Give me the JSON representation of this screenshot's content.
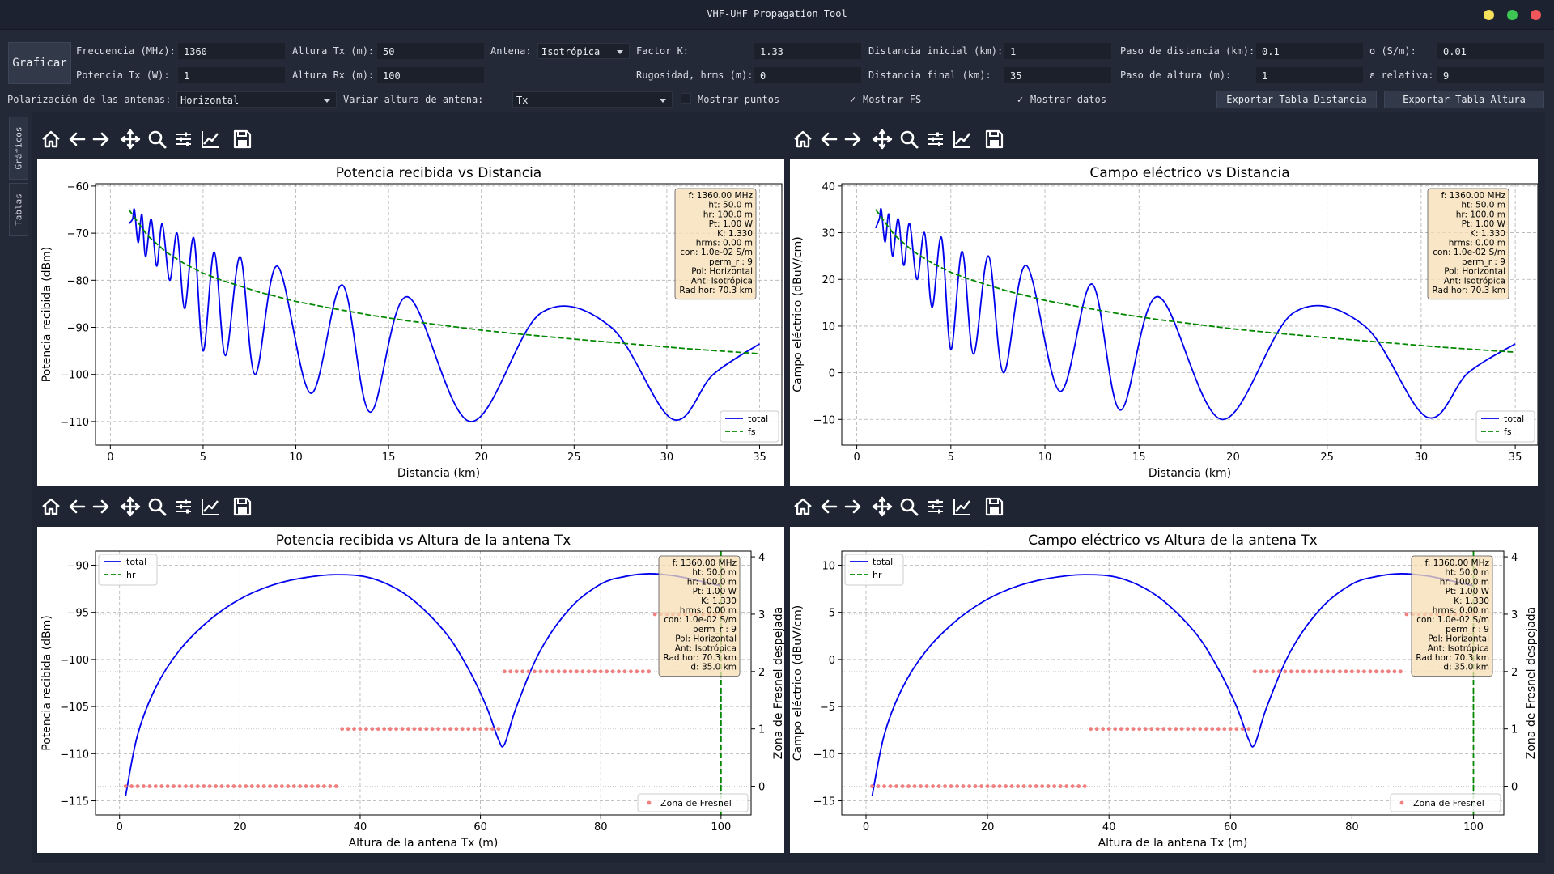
{
  "window": {
    "title": "VHF-UHF Propagation Tool"
  },
  "controls": {
    "graph_button": "Graficar",
    "freq_label": "Frecuencia (MHz):",
    "freq_value": "1360",
    "ptx_label": "Potencia Tx (W):",
    "ptx_value": "1",
    "htx_label": "Altura Tx (m):",
    "htx_value": "50",
    "hrx_label": "Altura Rx (m):",
    "hrx_value": "100",
    "antenna_label": "Antena:",
    "antenna_value": "Isotrópica",
    "k_label": "Factor K:",
    "k_value": "1.33",
    "rough_label": "Rugosidad, hrms (m):",
    "rough_value": "0",
    "dini_label": "Distancia inicial (km):",
    "dini_value": "1",
    "dfin_label": "Distancia final (km):",
    "dfin_value": "35",
    "dstep_label": "Paso de distancia (km):",
    "dstep_value": "0.1",
    "hstep_label": "Paso de altura (m):",
    "hstep_value": "1",
    "sigma_label": "σ (S/m):",
    "sigma_value": "0.01",
    "eps_label": "ε relativa:",
    "eps_value": "9",
    "pol_label": "Polarización de las antenas:",
    "pol_value": "Horizontal",
    "vary_label": "Variar altura de antena:",
    "vary_value": "Tx",
    "show_points": "Mostrar puntos",
    "show_points_checked": false,
    "show_fs": "Mostrar FS",
    "show_fs_checked": true,
    "show_data": "Mostrar datos",
    "show_data_checked": true,
    "export_dist": "Exportar Tabla Distancia",
    "export_height": "Exportar Tabla Altura",
    "tab_graphs": "Gráficos",
    "tab_tables": "Tablas",
    "check_mark": "✓"
  },
  "toolbar_icons": [
    "home-icon",
    "back-arrow-icon",
    "forward-arrow-icon",
    "pan-icon",
    "zoom-icon",
    "configure-subplots-icon",
    "edit-axis-icon",
    "save-icon"
  ],
  "colors": {
    "total": "#0000ee",
    "fs": "#008800",
    "hr": "#008800",
    "fresnel": "#f08080",
    "infobox_bg": "#f5deb3"
  },
  "infobox": {
    "lines": [
      "f: 1360.00 MHz",
      "ht: 50.0 m",
      "hr: 100.0 m",
      "Pt: 1.00 W",
      "K: 1.330",
      "hrms: 0.00 m",
      "con: 1.0e-02 S/m",
      "perm_r : 9",
      "Pol: Horizontal",
      "Ant: Isotrópica",
      "Rad hor: 70.3 km"
    ],
    "extra_line": "d: 35.0 km"
  },
  "plots": {
    "p1": {
      "title": "Potencia recibida vs Distancia",
      "xlabel": "Distancia (km)",
      "ylabel": "Potencia recibida (dBm)",
      "xticks": [
        "0",
        "5",
        "10",
        "15",
        "20",
        "25",
        "30",
        "35"
      ],
      "yticks": [
        "−60",
        "−70",
        "−80",
        "−90",
        "−100",
        "−110"
      ],
      "legend": [
        "total",
        "fs"
      ]
    },
    "p2": {
      "title": "Campo eléctrico vs Distancia",
      "xlabel": "Distancia (km)",
      "ylabel": "Campo eléctrico (dBuV/cm)",
      "xticks": [
        "0",
        "5",
        "10",
        "15",
        "20",
        "25",
        "30",
        "35"
      ],
      "yticks": [
        "40",
        "30",
        "20",
        "10",
        "0",
        "−10"
      ],
      "legend": [
        "total",
        "fs"
      ]
    },
    "p3": {
      "title": "Potencia recibida vs Altura de la antena Tx",
      "xlabel": "Altura de la antena Tx (m)",
      "ylabel": "Potencia recibida (dBm)",
      "y2label": "Zona de Fresnel despejada",
      "xticks": [
        "0",
        "20",
        "40",
        "60",
        "80",
        "100"
      ],
      "yticks": [
        "−90",
        "−95",
        "−100",
        "−105",
        "−110",
        "−115"
      ],
      "y2ticks": [
        "4",
        "3",
        "2",
        "1",
        "0"
      ],
      "legend": [
        "total",
        "hr"
      ],
      "legend2": "Zona de Fresnel"
    },
    "p4": {
      "title": "Campo eléctrico vs Altura de la antena Tx",
      "xlabel": "Altura de la antena Tx (m)",
      "ylabel": "Campo eléctrico (dBuV/cm)",
      "y2label": "Zona de Fresnel despejada",
      "xticks": [
        "0",
        "20",
        "40",
        "60",
        "80",
        "100"
      ],
      "yticks": [
        "10",
        "5",
        "0",
        "−5",
        "−10",
        "−15"
      ],
      "y2ticks": [
        "4",
        "3",
        "2",
        "1",
        "0"
      ],
      "legend": [
        "total",
        "hr"
      ],
      "legend2": "Zona de Fresnel"
    }
  },
  "chart_data": [
    {
      "type": "line",
      "title": "Potencia recibida vs Distancia",
      "xlabel": "Distancia (km)",
      "ylabel": "Potencia recibida (dBm)",
      "xlim": [
        -0.8,
        36.2
      ],
      "ylim": [
        -115,
        -59.5
      ],
      "grid": true,
      "legend_position": "lower-right",
      "series": [
        {
          "name": "total",
          "x": [
            1.0,
            1.2,
            1.3,
            1.5,
            1.7,
            1.9,
            2.2,
            2.5,
            2.8,
            3.2,
            3.6,
            4.0,
            4.5,
            5.0,
            5.6,
            6.2,
            7.0,
            7.8,
            9.0,
            10.8,
            12.5,
            14.0,
            16.0,
            19.4,
            23.2,
            27.0,
            30.3,
            32.5,
            35.0
          ],
          "y": [
            -68,
            -67,
            -65,
            -72,
            -66,
            -75,
            -67,
            -77,
            -68,
            -80,
            -70,
            -86,
            -71,
            -95,
            -74,
            -96,
            -75,
            -100,
            -77,
            -104,
            -81,
            -108,
            -83.5,
            -110,
            -87,
            -90,
            -109.5,
            -100,
            -93.5
          ]
        },
        {
          "name": "fs",
          "x": [
            1,
            2,
            3,
            4,
            5,
            6,
            8,
            10,
            12,
            14,
            16,
            18,
            20,
            22,
            25,
            28,
            31,
            35
          ],
          "y": [
            -65,
            -70.5,
            -74,
            -76.5,
            -78.5,
            -80,
            -82.5,
            -84.5,
            -86,
            -87.4,
            -88.6,
            -89.6,
            -90.6,
            -91.4,
            -92.5,
            -93.5,
            -94.5,
            -95.6
          ]
        }
      ]
    },
    {
      "type": "line",
      "title": "Campo eléctrico vs Distancia",
      "xlabel": "Distancia (km)",
      "ylabel": "Campo eléctrico (dBuV/cm)",
      "xlim": [
        -0.8,
        36.2
      ],
      "ylim": [
        -15.5,
        40.5
      ],
      "grid": true,
      "legend_position": "lower-right",
      "series": [
        {
          "name": "total",
          "x": [
            1.0,
            1.2,
            1.3,
            1.5,
            1.7,
            1.9,
            2.2,
            2.5,
            2.8,
            3.2,
            3.6,
            4.0,
            4.5,
            5.0,
            5.6,
            6.2,
            7.0,
            7.8,
            9.0,
            10.8,
            12.5,
            14.0,
            16.0,
            19.4,
            23.2,
            27.0,
            30.3,
            32.5,
            35.0
          ],
          "y": [
            31,
            33,
            35,
            28,
            34,
            25,
            33,
            23,
            32,
            20,
            30,
            14,
            29,
            5,
            26,
            4,
            25,
            0,
            23,
            -4,
            19,
            -8,
            16.3,
            -10,
            12.8,
            10,
            -9.5,
            0,
            6.2
          ]
        },
        {
          "name": "fs",
          "x": [
            1,
            2,
            3,
            4,
            5,
            6,
            8,
            10,
            12,
            14,
            16,
            18,
            20,
            22,
            25,
            28,
            31,
            35
          ],
          "y": [
            35,
            29.5,
            26,
            23.5,
            21.5,
            20,
            17.5,
            15.5,
            14,
            12.6,
            11.4,
            10.4,
            9.4,
            8.6,
            7.5,
            6.5,
            5.5,
            4.4
          ]
        }
      ]
    },
    {
      "type": "line",
      "title": "Potencia recibida vs Altura de la antena Tx",
      "xlabel": "Altura de la antena Tx (m)",
      "ylabel": "Potencia recibida (dBm)",
      "y2label": "Zona de Fresnel despejada",
      "xlim": [
        -4,
        105
      ],
      "ylim": [
        -116.5,
        -88.5
      ],
      "y2lim": [
        -0.5,
        4.1
      ],
      "grid": true,
      "series": [
        {
          "name": "total",
          "x": [
            1,
            3,
            6,
            10,
            15,
            20,
            25,
            30,
            36,
            42,
            48,
            54,
            58,
            61,
            63,
            64,
            66,
            70,
            75,
            80,
            84,
            88,
            92,
            96,
            100
          ],
          "y": [
            -114.5,
            -108,
            -103,
            -99,
            -95.8,
            -93.6,
            -92.2,
            -91.4,
            -91,
            -91.4,
            -93.3,
            -97,
            -101,
            -105,
            -108.5,
            -109,
            -105,
            -99,
            -94.5,
            -92,
            -91.2,
            -90.9,
            -91.1,
            -91.6,
            -92.2
          ]
        },
        {
          "name": "hr",
          "x": [
            100,
            100
          ],
          "y": [
            -116.5,
            -88.5
          ]
        },
        {
          "name": "Zona de Fresnel",
          "axis": "right",
          "segments": [
            {
              "x0": 1,
              "x1": 36,
              "y": 0
            },
            {
              "x0": 37,
              "x1": 63,
              "y": 1
            },
            {
              "x0": 64,
              "x1": 88,
              "y": 2
            },
            {
              "x0": 89,
              "x1": 100,
              "y": 3
            }
          ]
        }
      ]
    },
    {
      "type": "line",
      "title": "Campo eléctrico vs Altura de la antena Tx",
      "xlabel": "Altura de la antena Tx (m)",
      "ylabel": "Campo eléctrico (dBuV/cm)",
      "y2label": "Zona de Fresnel despejada",
      "xlim": [
        -4,
        105
      ],
      "ylim": [
        -16.5,
        11.5
      ],
      "y2lim": [
        -0.5,
        4.1
      ],
      "grid": true,
      "series": [
        {
          "name": "total",
          "x": [
            1,
            3,
            6,
            10,
            15,
            20,
            25,
            30,
            36,
            42,
            48,
            54,
            58,
            61,
            63,
            64,
            66,
            70,
            75,
            80,
            84,
            88,
            92,
            96,
            100
          ],
          "y": [
            -14.5,
            -8,
            -3,
            1,
            4.2,
            6.4,
            7.8,
            8.6,
            9,
            8.6,
            6.7,
            3,
            -1,
            -5,
            -8.5,
            -9,
            -5,
            1,
            5.5,
            8,
            8.8,
            9.1,
            8.9,
            8.4,
            7.8
          ]
        },
        {
          "name": "hr",
          "x": [
            100,
            100
          ],
          "y": [
            -16.5,
            11.5
          ]
        },
        {
          "name": "Zona de Fresnel",
          "axis": "right",
          "segments": [
            {
              "x0": 1,
              "x1": 36,
              "y": 0
            },
            {
              "x0": 37,
              "x1": 63,
              "y": 1
            },
            {
              "x0": 64,
              "x1": 88,
              "y": 2
            },
            {
              "x0": 89,
              "x1": 100,
              "y": 3
            }
          ]
        }
      ]
    }
  ]
}
